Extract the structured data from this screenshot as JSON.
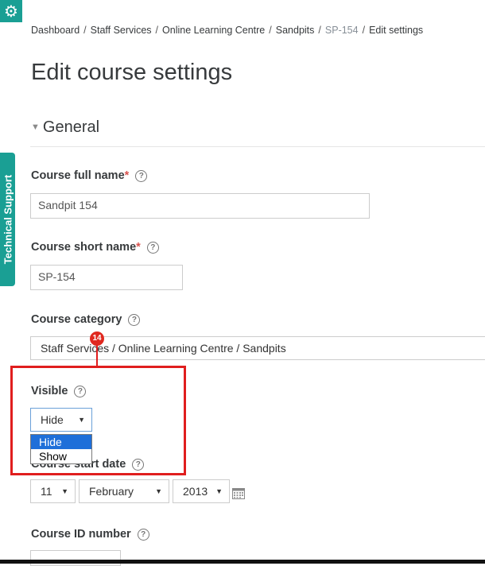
{
  "breadcrumb": {
    "items": [
      "Dashboard",
      "Staff Services",
      "Online Learning Centre",
      "Sandpits",
      "SP-154",
      "Edit settings"
    ]
  },
  "page": {
    "title": "Edit course settings"
  },
  "section": {
    "title": "General"
  },
  "side_tab": {
    "label": "Technical Support"
  },
  "fields": {
    "full_name": {
      "label": "Course full name",
      "required": "*",
      "value": "Sandpit 154"
    },
    "short_name": {
      "label": "Course short name",
      "required": "*",
      "value": "SP-154"
    },
    "category": {
      "label": "Course category",
      "value": "Staff Services / Online Learning Centre / Sandpits"
    },
    "visible": {
      "label": "Visible",
      "value": "Hide",
      "options": [
        "Hide",
        "Show"
      ],
      "selected_option": "Hide"
    },
    "start_date": {
      "label": "Course start date",
      "day": "11",
      "month": "February",
      "year": "2013"
    },
    "id_number": {
      "label": "Course ID number",
      "value": ""
    }
  },
  "annotation": {
    "step_number": "14",
    "color": "#e01e1e"
  },
  "icons": {
    "gear": "gear-icon",
    "help": "help-icon",
    "calendar": "calendar-icon",
    "collapse": "triangle-down-icon"
  },
  "colors": {
    "accent": "#1a9f94",
    "required": "#d9534f",
    "highlight": "#e01e1e",
    "selected_option": "#1e6fd9"
  }
}
